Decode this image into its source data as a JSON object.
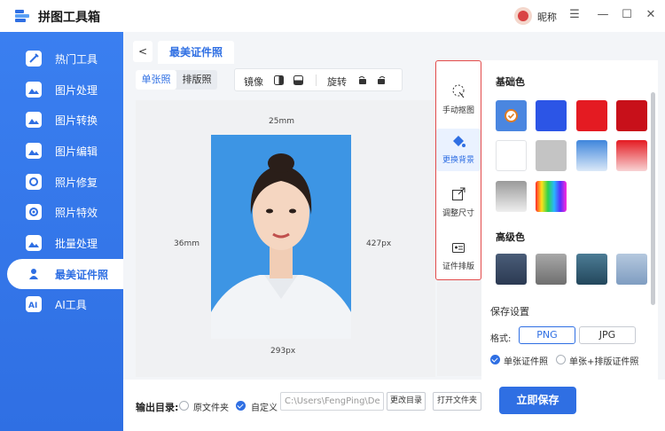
{
  "app": {
    "title": "拼图工具箱",
    "nickname": "昵称"
  },
  "window_controls": {
    "menu": "☰",
    "minimize": "—",
    "maximize": "☐",
    "close": "✕"
  },
  "sidebar": {
    "items": [
      {
        "label": "热门工具",
        "icon": "tools-icon"
      },
      {
        "label": "图片处理",
        "icon": "image-process-icon"
      },
      {
        "label": "图片转换",
        "icon": "image-convert-icon"
      },
      {
        "label": "图片编辑",
        "icon": "image-edit-icon"
      },
      {
        "label": "照片修复",
        "icon": "photo-repair-icon"
      },
      {
        "label": "照片特效",
        "icon": "photo-effect-icon"
      },
      {
        "label": "批量处理",
        "icon": "batch-icon"
      },
      {
        "label": "最美证件照",
        "icon": "id-photo-icon",
        "active": true
      },
      {
        "label": "AI工具",
        "icon": "ai-icon"
      }
    ]
  },
  "tab": {
    "back": "<",
    "title": "最美证件照"
  },
  "modes": [
    "单张照",
    "排版照"
  ],
  "toolbar": {
    "mirror": "镜像",
    "rotate": "旋转"
  },
  "canvas": {
    "width_mm": "25mm",
    "height_mm": "36mm",
    "height_px": "427px",
    "width_px": "293px"
  },
  "side_tools": [
    "手动抠图",
    "更换背景",
    "调整尺寸",
    "证件排版"
  ],
  "colors": {
    "basic_title": "基础色",
    "advanced_title": "高级色",
    "accent": "#2f6fe3",
    "basic": [
      "#4a86e0",
      "#2c55e6",
      "#e41b22",
      "#c8101a",
      "#ffffff",
      "#c4c4c4",
      "blue-gradient",
      "red-gradient",
      "gray-gradient",
      "rainbow"
    ],
    "advanced": [
      "#34445c",
      "#8a8a8a",
      "#2f5a72",
      "#9ab3cf"
    ]
  },
  "save": {
    "title": "保存设置",
    "format_label": "格式:",
    "formats": [
      "PNG",
      "JPG"
    ],
    "options": [
      "单张证件照",
      "单张+排版证件照"
    ]
  },
  "bottom": {
    "output_label": "输出目录:",
    "original_folder": "原文件夹",
    "custom": "自定义",
    "path": "C:\\Users\\FengPing\\De",
    "change_dir": "更改目录",
    "open_folder": "打开文件夹",
    "save_now": "立即保存"
  }
}
